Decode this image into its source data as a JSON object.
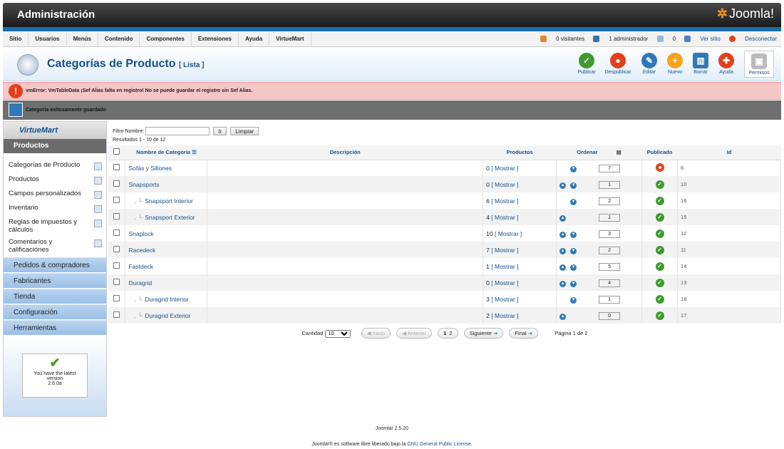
{
  "header": {
    "title": "Administración",
    "logo": "Joomla!"
  },
  "menu": [
    "Sitio",
    "Usuarios",
    "Menús",
    "Contenido",
    "Componentes",
    "Extensiones",
    "Ayuda",
    "VirtueMart"
  ],
  "status": {
    "visitors": "0 visitantes",
    "admins": "1 administrador",
    "messages": "0",
    "view_site": "Ver sitio",
    "logout": "Desconectar"
  },
  "page": {
    "title": "Categorías de Producto",
    "subtitle": "[ Lista ]"
  },
  "toolbar": [
    {
      "label": "Publicar",
      "icon": "check-icon",
      "color": "#3e9a2d"
    },
    {
      "label": "Despublicar",
      "icon": "stop-icon",
      "color": "#e2401c"
    },
    {
      "label": "Editar",
      "icon": "edit-icon",
      "color": "#2f79b9"
    },
    {
      "label": "Nuevo",
      "icon": "plus-icon",
      "color": "#f7a21b"
    },
    {
      "label": "Borrar",
      "icon": "trash-icon",
      "color": "#2f79b9"
    },
    {
      "label": "Ayuda",
      "icon": "help-icon",
      "color": "#e2401c"
    },
    {
      "label": "Permisos",
      "icon": "lock-icon",
      "color": "#999999"
    }
  ],
  "messages": {
    "error": "vmError: VmTableData ¡Sef Alias falta en registro! No se puede guardar el registro sin Sef Alias.",
    "success": "Categoria exitosamente guardado"
  },
  "sidebar": {
    "brand": "VirtueMart",
    "section": "Productos",
    "links": [
      "Categorías de Producto",
      "Productos",
      "Campos personalizados",
      "Inventario",
      "Reglas de impuestos y cálculos",
      "Comentarios y calificaciónes"
    ],
    "accordion": [
      "Pedidos & compradores",
      "Fabricantes",
      "Tienda",
      "Configuración",
      "Herramientas"
    ],
    "version": {
      "line1": "You have the latest",
      "line2": "version",
      "line3": "2.6.0a"
    }
  },
  "filter": {
    "label": "Filtro Nombre:",
    "go": "Ir",
    "clear": "Limpiar",
    "results": "Resultados 1 - 10 de 12"
  },
  "table": {
    "headers": {
      "name": "Nombre de Categoría",
      "desc": "Descripción",
      "products": "Productos",
      "order": "Ordenar",
      "published": "Publicado",
      "id": "Id"
    },
    "rows": [
      {
        "name": "Sofás y Sillones",
        "child": false,
        "count": "0",
        "show": "[ Mostrar ]",
        "up": false,
        "down": true,
        "order": "7",
        "published": false,
        "id": "6"
      },
      {
        "name": "Snapsports",
        "child": false,
        "count": "0",
        "show": "[ Mostrar ]",
        "up": true,
        "down": true,
        "order": "1",
        "published": true,
        "id": "10"
      },
      {
        "name": "Snapsport Interior",
        "child": true,
        "count": "6",
        "show": "[ Mostrar ]",
        "up": false,
        "down": true,
        "order": "2",
        "published": true,
        "id": "16"
      },
      {
        "name": "Snapsport Exterior",
        "child": true,
        "count": "4",
        "show": "[ Mostrar ]",
        "up": true,
        "down": false,
        "order": "1",
        "published": true,
        "id": "15"
      },
      {
        "name": "Snaplock",
        "child": false,
        "count": "10",
        "show": "[ Mostrar ]",
        "up": true,
        "down": true,
        "order": "3",
        "published": true,
        "id": "12"
      },
      {
        "name": "Racedeck",
        "child": false,
        "count": "7",
        "show": "[ Mostrar ]",
        "up": true,
        "down": true,
        "order": "2",
        "published": true,
        "id": "11"
      },
      {
        "name": "Fastdeck",
        "child": false,
        "count": "1",
        "show": "[ Mostrar ]",
        "up": true,
        "down": true,
        "order": "5",
        "published": true,
        "id": "14"
      },
      {
        "name": "Duragrid",
        "child": false,
        "count": "0",
        "show": "[ Mostrar ]",
        "up": true,
        "down": true,
        "order": "4",
        "published": true,
        "id": "13"
      },
      {
        "name": "Duragrid Interior",
        "child": true,
        "count": "3",
        "show": "[ Mostrar ]",
        "up": false,
        "down": true,
        "order": "1",
        "published": true,
        "id": "18"
      },
      {
        "name": "Duragrid Exterior",
        "child": true,
        "count": "2",
        "show": "[ Mostrar ]",
        "up": true,
        "down": false,
        "order": "0",
        "published": true,
        "id": "17"
      }
    ]
  },
  "pager": {
    "quantity_label": "Cantidad",
    "quantity": "10",
    "start": "Inicio",
    "prev": "Anterior",
    "pages": [
      "1",
      "2"
    ],
    "next": "Siguiente",
    "end": "Final",
    "info": "Página 1 de 2"
  },
  "footer": {
    "version": "Joomla! 2.5.20",
    "license_pre": "Joomla!® es software libre liberado bajo la",
    "license_link": "GNU General Public License",
    "license_post": "."
  }
}
